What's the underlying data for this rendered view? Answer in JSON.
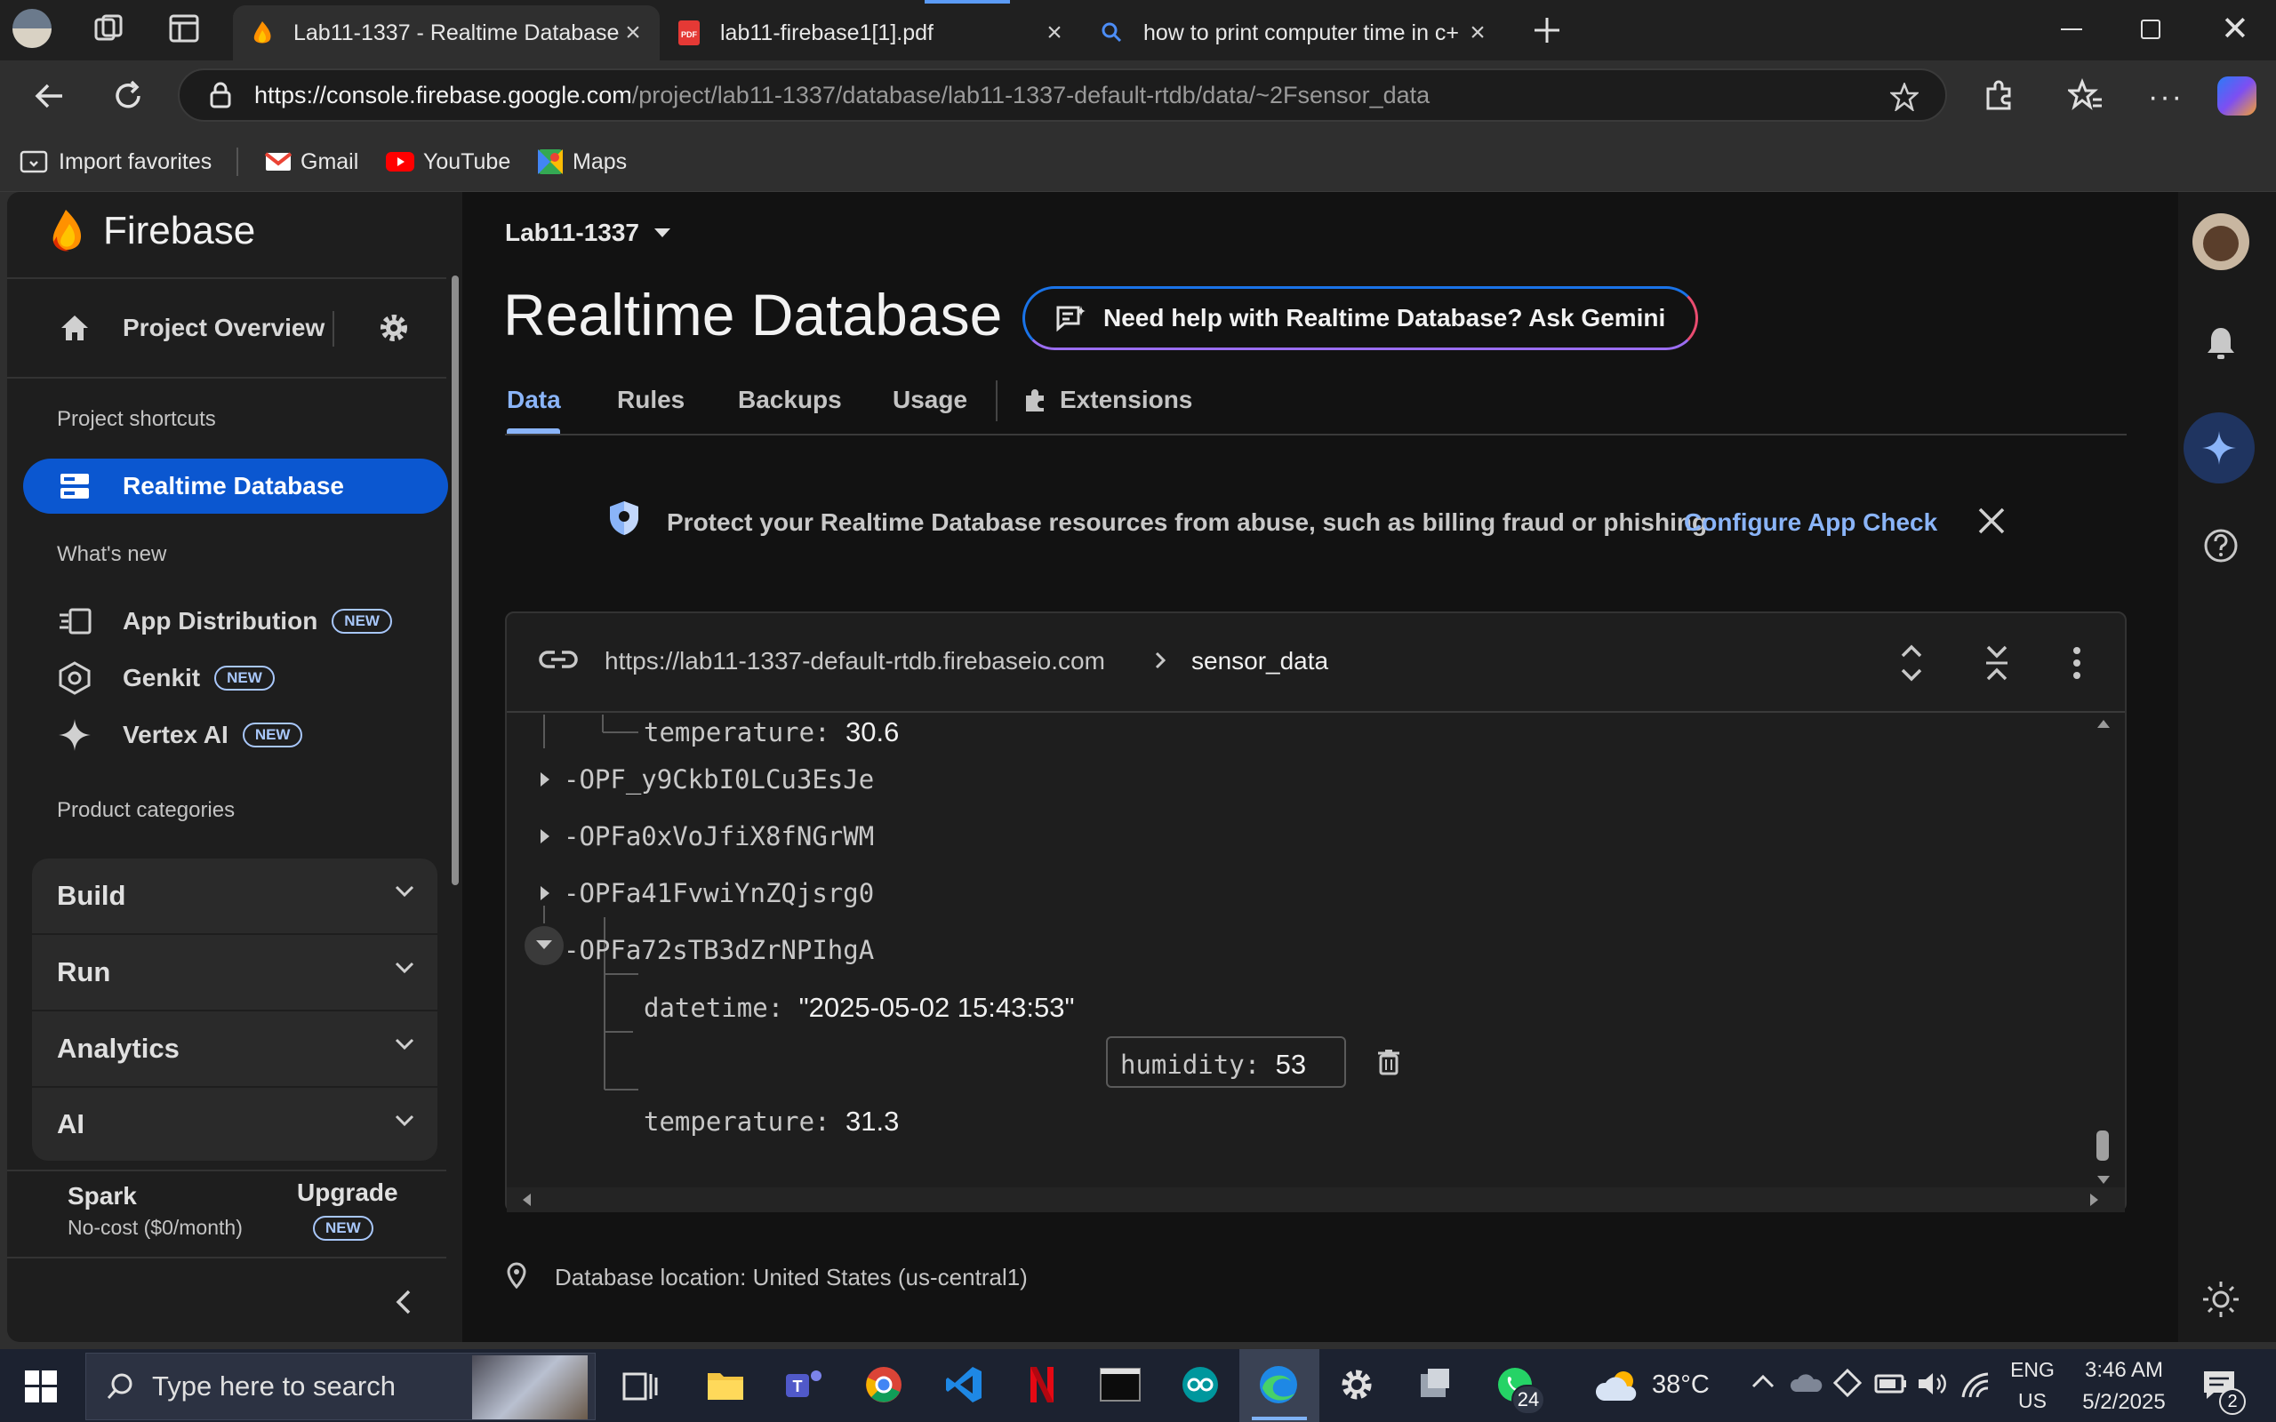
{
  "browser": {
    "tabs": [
      {
        "title": "Lab11-1337 - Realtime Database",
        "active": true
      },
      {
        "title": "lab11-firebase1[1].pdf",
        "active": false
      },
      {
        "title": "how to print computer time in c+",
        "active": false
      }
    ],
    "url_host": "https://console.firebase.google.com",
    "url_path": "/project/lab11-1337/database/lab11-1337-default-rtdb/data/~2Fsensor_data",
    "favorites": [
      "Import favorites",
      "Gmail",
      "YouTube",
      "Maps"
    ]
  },
  "sidebar": {
    "brand": "Firebase",
    "project_overview": "Project Overview",
    "shortcuts_heading": "Project shortcuts",
    "active_item": "Realtime Database",
    "whats_new_heading": "What's new",
    "new_items": [
      {
        "label": "App Distribution",
        "badge": "NEW"
      },
      {
        "label": "Genkit",
        "badge": "NEW"
      },
      {
        "label": "Vertex AI",
        "badge": "NEW"
      }
    ],
    "categories_heading": "Product categories",
    "categories": [
      "Build",
      "Run",
      "Analytics",
      "AI"
    ],
    "plan_name": "Spark",
    "plan_desc": "No-cost ($0/month)",
    "upgrade": "Upgrade",
    "upgrade_badge": "NEW"
  },
  "header": {
    "project": "Lab11-1337",
    "title": "Realtime Database",
    "gemini_button": "Need help with Realtime Database? Ask Gemini",
    "tabs": [
      "Data",
      "Rules",
      "Backups",
      "Usage",
      "Extensions"
    ],
    "active_tab": "Data"
  },
  "banner": {
    "text": "Protect your Realtime Database resources from abuse, such as billing fraud or phishing",
    "link": "Configure App Check"
  },
  "db": {
    "root_url": "https://lab11-1337-default-rtdb.firebaseio.com",
    "path": "sensor_data",
    "rows": [
      {
        "type": "leaf",
        "key": "temperature",
        "value": "30.6"
      },
      {
        "type": "node",
        "key": "-OPF_y9CkbI0LCu3EsJe"
      },
      {
        "type": "node",
        "key": "-OPFa0xVoJfiX8fNGrWM"
      },
      {
        "type": "node",
        "key": "-OPFa41FvwiYnZQjsrg0"
      },
      {
        "type": "node-open",
        "key": "-OPFa72sTB3dZrNPIhgA"
      },
      {
        "type": "leaf",
        "key": "datetime",
        "value": "\"2025-05-02 15:43:53\""
      },
      {
        "type": "leaf",
        "key": "humidity",
        "value": "53"
      },
      {
        "type": "leaf",
        "key": "temperature",
        "value": "31.3"
      }
    ],
    "location": "Database location: United States (us-central1)"
  },
  "taskbar": {
    "search_placeholder": "Type here to search",
    "weather": "38°C",
    "lang": "ENG",
    "region": "US",
    "time": "3:46 AM",
    "date": "5/2/2025",
    "whatsapp_badge": "24",
    "notif_count": "2"
  },
  "colors": {
    "accent": "#8ab4f8",
    "active_nav": "#0b57d0",
    "firebase_orange": "#ff9100"
  }
}
